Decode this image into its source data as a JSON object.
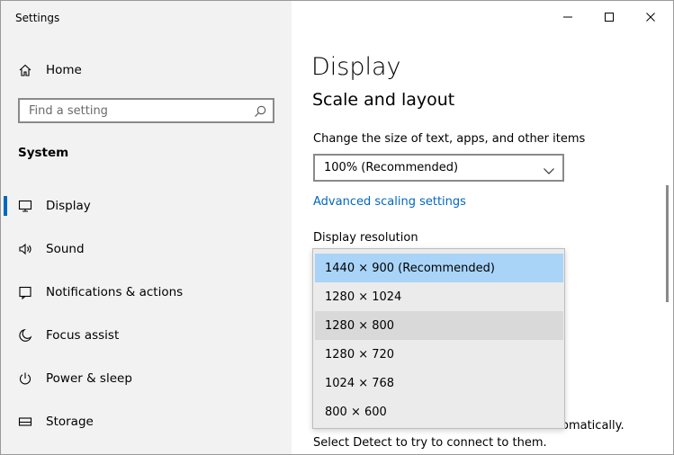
{
  "window": {
    "title": "Settings"
  },
  "nav": {
    "home_label": "Home",
    "search_placeholder": "Find a setting",
    "section_label": "System",
    "items": [
      {
        "label": "Display",
        "icon": "monitor-icon",
        "selected": true
      },
      {
        "label": "Sound",
        "icon": "speaker-icon"
      },
      {
        "label": "Notifications & actions",
        "icon": "notification-icon"
      },
      {
        "label": "Focus assist",
        "icon": "moon-icon"
      },
      {
        "label": "Power & sleep",
        "icon": "power-icon"
      },
      {
        "label": "Storage",
        "icon": "storage-icon"
      }
    ]
  },
  "main": {
    "title": "Display",
    "subtitle": "Scale and layout",
    "scale_label": "Change the size of text, apps, and other items",
    "scale_value": "100% (Recommended)",
    "advanced_link": "Advanced scaling settings",
    "resolution_label": "Display resolution",
    "resolution_options": [
      "1440 × 900 (Recommended)",
      "1280 × 1024",
      "1280 × 800",
      "1280 × 720",
      "1024 × 768",
      "800 × 600"
    ],
    "resolution_selected": "1440 × 900 (Recommended)",
    "bottom_text_line1_end": "omatically.",
    "bottom_text_line2": "Select Detect to try to connect to them."
  },
  "colors": {
    "accent": "#0067c0",
    "nav_background": "#f2f2f2",
    "selected_option": "#a9d4f8",
    "hover_option": "#d9d9d9"
  }
}
